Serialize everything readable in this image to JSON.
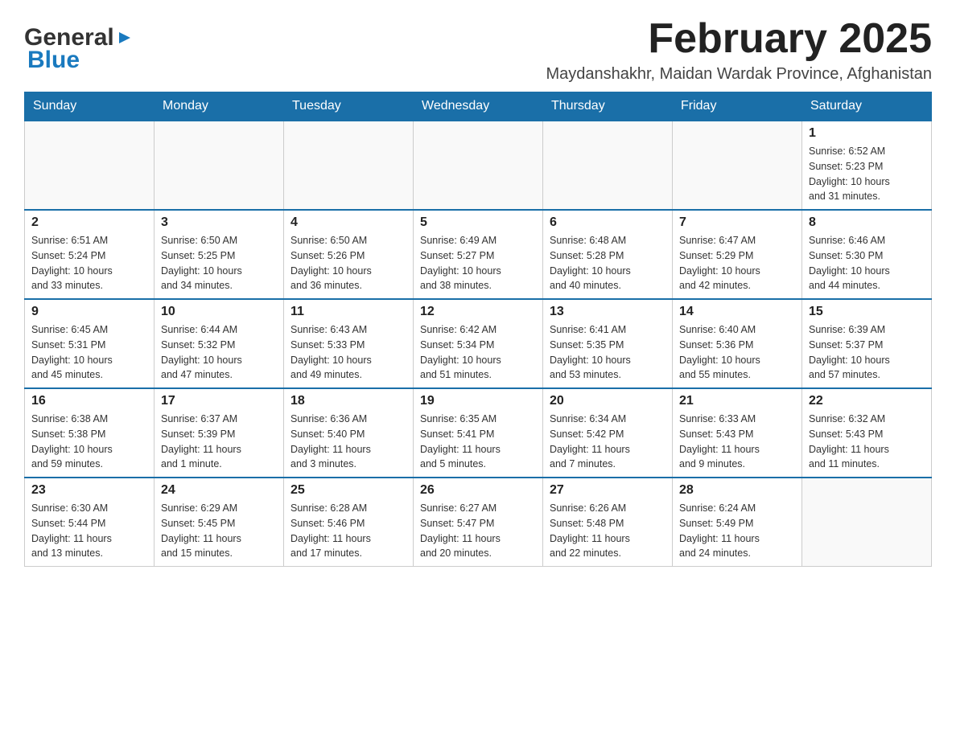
{
  "logo": {
    "general": "General",
    "blue": "Blue"
  },
  "header": {
    "month": "February 2025",
    "location": "Maydanshakhr, Maidan Wardak Province, Afghanistan"
  },
  "weekdays": [
    "Sunday",
    "Monday",
    "Tuesday",
    "Wednesday",
    "Thursday",
    "Friday",
    "Saturday"
  ],
  "weeks": [
    [
      {
        "day": "",
        "info": ""
      },
      {
        "day": "",
        "info": ""
      },
      {
        "day": "",
        "info": ""
      },
      {
        "day": "",
        "info": ""
      },
      {
        "day": "",
        "info": ""
      },
      {
        "day": "",
        "info": ""
      },
      {
        "day": "1",
        "info": "Sunrise: 6:52 AM\nSunset: 5:23 PM\nDaylight: 10 hours\nand 31 minutes."
      }
    ],
    [
      {
        "day": "2",
        "info": "Sunrise: 6:51 AM\nSunset: 5:24 PM\nDaylight: 10 hours\nand 33 minutes."
      },
      {
        "day": "3",
        "info": "Sunrise: 6:50 AM\nSunset: 5:25 PM\nDaylight: 10 hours\nand 34 minutes."
      },
      {
        "day": "4",
        "info": "Sunrise: 6:50 AM\nSunset: 5:26 PM\nDaylight: 10 hours\nand 36 minutes."
      },
      {
        "day": "5",
        "info": "Sunrise: 6:49 AM\nSunset: 5:27 PM\nDaylight: 10 hours\nand 38 minutes."
      },
      {
        "day": "6",
        "info": "Sunrise: 6:48 AM\nSunset: 5:28 PM\nDaylight: 10 hours\nand 40 minutes."
      },
      {
        "day": "7",
        "info": "Sunrise: 6:47 AM\nSunset: 5:29 PM\nDaylight: 10 hours\nand 42 minutes."
      },
      {
        "day": "8",
        "info": "Sunrise: 6:46 AM\nSunset: 5:30 PM\nDaylight: 10 hours\nand 44 minutes."
      }
    ],
    [
      {
        "day": "9",
        "info": "Sunrise: 6:45 AM\nSunset: 5:31 PM\nDaylight: 10 hours\nand 45 minutes."
      },
      {
        "day": "10",
        "info": "Sunrise: 6:44 AM\nSunset: 5:32 PM\nDaylight: 10 hours\nand 47 minutes."
      },
      {
        "day": "11",
        "info": "Sunrise: 6:43 AM\nSunset: 5:33 PM\nDaylight: 10 hours\nand 49 minutes."
      },
      {
        "day": "12",
        "info": "Sunrise: 6:42 AM\nSunset: 5:34 PM\nDaylight: 10 hours\nand 51 minutes."
      },
      {
        "day": "13",
        "info": "Sunrise: 6:41 AM\nSunset: 5:35 PM\nDaylight: 10 hours\nand 53 minutes."
      },
      {
        "day": "14",
        "info": "Sunrise: 6:40 AM\nSunset: 5:36 PM\nDaylight: 10 hours\nand 55 minutes."
      },
      {
        "day": "15",
        "info": "Sunrise: 6:39 AM\nSunset: 5:37 PM\nDaylight: 10 hours\nand 57 minutes."
      }
    ],
    [
      {
        "day": "16",
        "info": "Sunrise: 6:38 AM\nSunset: 5:38 PM\nDaylight: 10 hours\nand 59 minutes."
      },
      {
        "day": "17",
        "info": "Sunrise: 6:37 AM\nSunset: 5:39 PM\nDaylight: 11 hours\nand 1 minute."
      },
      {
        "day": "18",
        "info": "Sunrise: 6:36 AM\nSunset: 5:40 PM\nDaylight: 11 hours\nand 3 minutes."
      },
      {
        "day": "19",
        "info": "Sunrise: 6:35 AM\nSunset: 5:41 PM\nDaylight: 11 hours\nand 5 minutes."
      },
      {
        "day": "20",
        "info": "Sunrise: 6:34 AM\nSunset: 5:42 PM\nDaylight: 11 hours\nand 7 minutes."
      },
      {
        "day": "21",
        "info": "Sunrise: 6:33 AM\nSunset: 5:43 PM\nDaylight: 11 hours\nand 9 minutes."
      },
      {
        "day": "22",
        "info": "Sunrise: 6:32 AM\nSunset: 5:43 PM\nDaylight: 11 hours\nand 11 minutes."
      }
    ],
    [
      {
        "day": "23",
        "info": "Sunrise: 6:30 AM\nSunset: 5:44 PM\nDaylight: 11 hours\nand 13 minutes."
      },
      {
        "day": "24",
        "info": "Sunrise: 6:29 AM\nSunset: 5:45 PM\nDaylight: 11 hours\nand 15 minutes."
      },
      {
        "day": "25",
        "info": "Sunrise: 6:28 AM\nSunset: 5:46 PM\nDaylight: 11 hours\nand 17 minutes."
      },
      {
        "day": "26",
        "info": "Sunrise: 6:27 AM\nSunset: 5:47 PM\nDaylight: 11 hours\nand 20 minutes."
      },
      {
        "day": "27",
        "info": "Sunrise: 6:26 AM\nSunset: 5:48 PM\nDaylight: 11 hours\nand 22 minutes."
      },
      {
        "day": "28",
        "info": "Sunrise: 6:24 AM\nSunset: 5:49 PM\nDaylight: 11 hours\nand 24 minutes."
      },
      {
        "day": "",
        "info": ""
      }
    ]
  ]
}
